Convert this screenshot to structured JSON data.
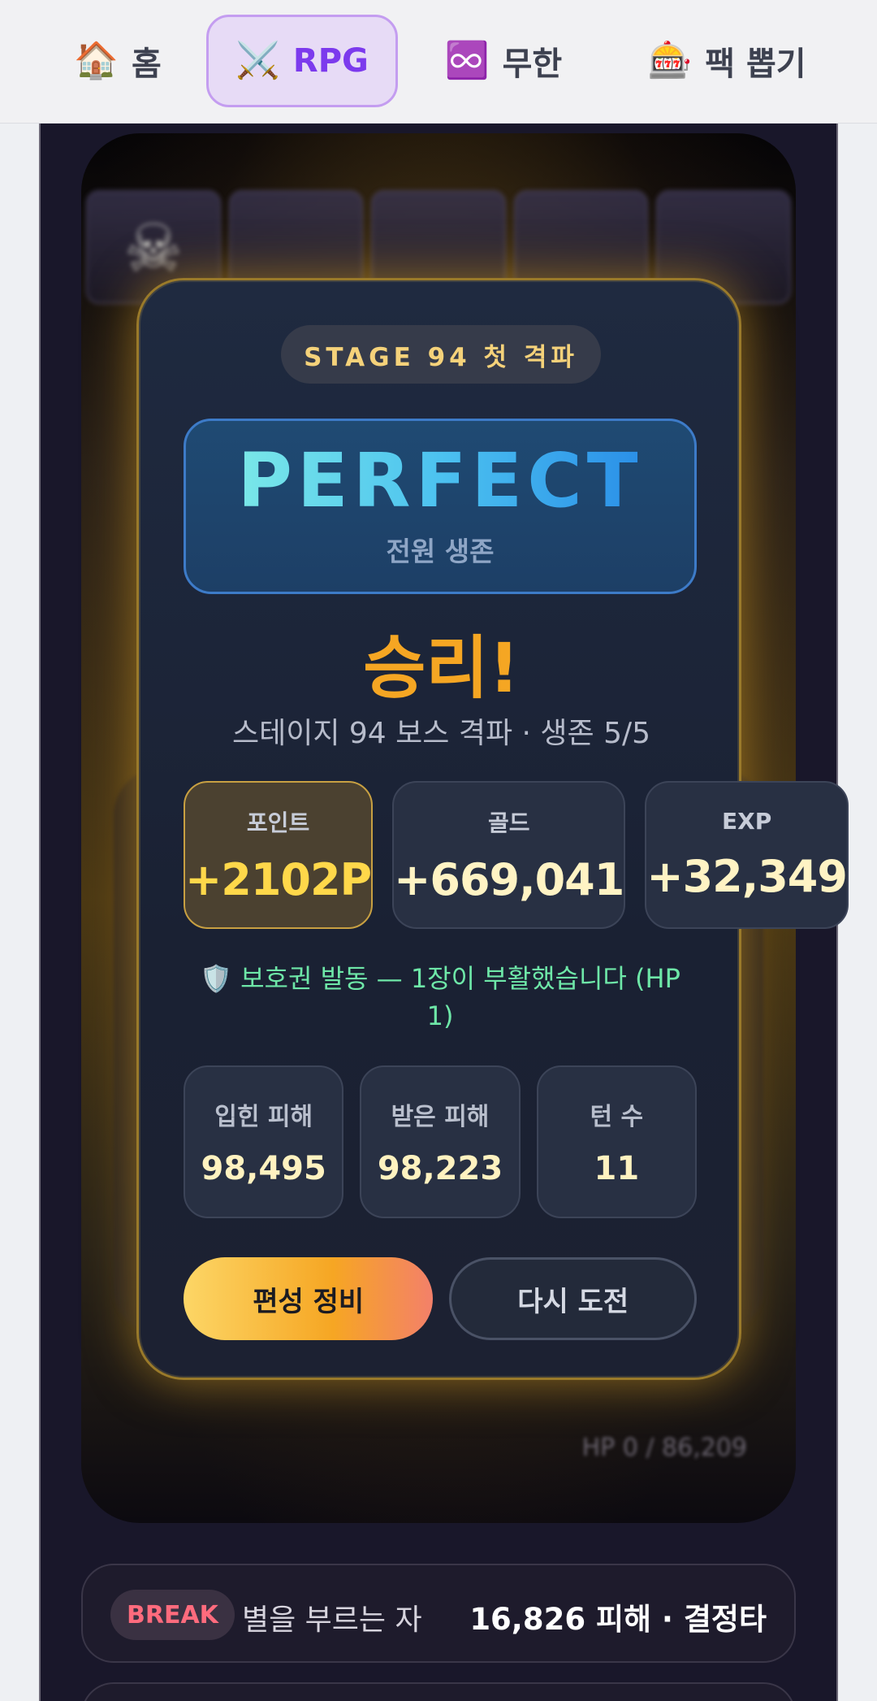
{
  "nav": {
    "items": [
      {
        "icon": "🏠",
        "label": "홈"
      },
      {
        "icon": "⚔️",
        "label": "RPG"
      },
      {
        "icon": "♾️",
        "label": "무한"
      },
      {
        "icon": "🎰",
        "label": "팩 뽑기"
      }
    ],
    "active_index": 1
  },
  "result": {
    "stage_badge": "STAGE 94 첫 격파",
    "grade": "PERFECT",
    "grade_sub": "전원 생존",
    "title": "승리!",
    "subtitle": "스테이지 94 보스 격파 · 생존 5/5",
    "rewards": [
      {
        "label": "포인트",
        "value": "+2102P"
      },
      {
        "label": "골드",
        "value": "+669,041"
      },
      {
        "label": "EXP",
        "value": "+32,349"
      }
    ],
    "protect_icon": "🛡️",
    "protect_text": "보호권 발동 — 1장이 부활했습니다 (HP 1)",
    "stats": [
      {
        "label": "입힌 피해",
        "value": "98,495"
      },
      {
        "label": "받은 피해",
        "value": "98,223"
      },
      {
        "label": "턴 수",
        "value": "11"
      }
    ],
    "buttons": {
      "primary": "편성 정비",
      "secondary": "다시 도전"
    }
  },
  "background": {
    "hp_text": "HP 0 / 86,209"
  },
  "log": {
    "badge": "BREAK",
    "name": "별을 부르는 자",
    "damage": "16,826 피해 · 결정타"
  },
  "colors": {
    "accent_gold": "#f5a623",
    "perfect_blue": "#4cc2f0",
    "protect_green": "#6ee7a8",
    "break_red": "#ff6b7d",
    "nav_active": "#7c3aed"
  }
}
